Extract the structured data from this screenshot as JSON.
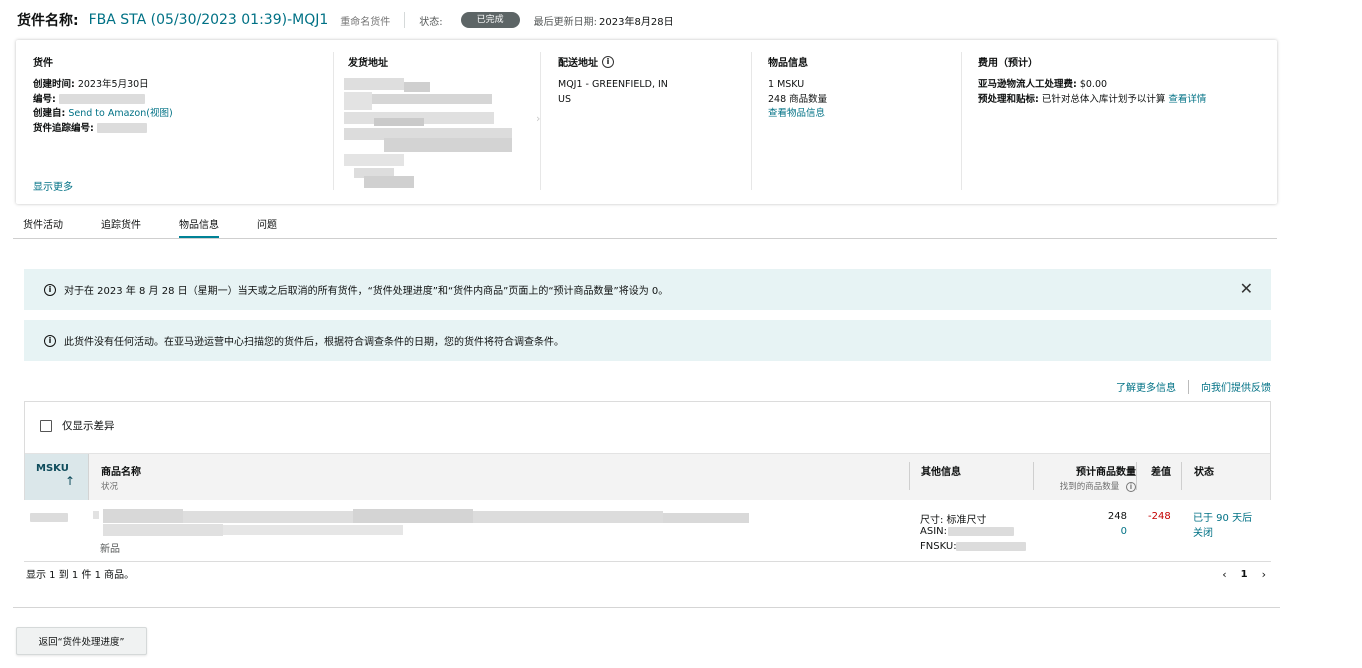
{
  "header": {
    "title_label": "货件名称:",
    "title_value": "FBA STA (05/30/2023 01:39)-MQJ1",
    "rename": "重命名货件",
    "status_label": "状态:",
    "status_badge": "已完成",
    "updated_label": "最后更新日期:",
    "updated_value": "2023年8月28日"
  },
  "card": {
    "shipment": {
      "heading": "货件",
      "created_label": "创建时间:",
      "created_value": "2023年5月30日",
      "id_label": "编号:",
      "created_from_label": "创建自:",
      "created_from_value": "Send to Amazon",
      "view_link": "(视图)",
      "tracking_label": "货件追踪编号:",
      "show_more": "显示更多"
    },
    "ship_from": {
      "heading": "发货地址"
    },
    "ship_to": {
      "heading": "配送地址",
      "line1": "MQJ1 - GREENFIELD, IN",
      "line2": "US"
    },
    "items": {
      "heading": "物品信息",
      "msku": "1 MSKU",
      "quantity": "248 商品数量",
      "view_link": "查看物品信息"
    },
    "fees": {
      "heading": "费用（预计）",
      "labor_label": "亚马逊物流人工处理费:",
      "labor_value": "$0.00",
      "prep_label": "预处理和贴标:",
      "prep_value": "已针对总体入库计划予以计算",
      "detail_link": "查看详情"
    }
  },
  "tabs": [
    "货件活动",
    "追踪货件",
    "物品信息",
    "问题"
  ],
  "alerts": {
    "cancel_notice": "对于在 2023 年 8 月 28 日（星期一）当天或之后取消的所有货件，“货件处理进度”和“货件内商品”页面上的“预计商品数量”将设为 0。",
    "no_activity": "此货件没有任何活动。在亚马逊运营中心扫描您的货件后，根据符合调查条件的日期，您的货件将符合调查条件。"
  },
  "links": {
    "learn_more": "了解更多信息",
    "feedback": "向我们提供反馈"
  },
  "table": {
    "filter_label": "仅显示差异",
    "headers": {
      "msku": "MSKU",
      "product_name": "商品名称",
      "product_sub": "状况",
      "other_info": "其他信息",
      "expected_qty": "预计商品数量",
      "found_qty": "找到的商品数量",
      "diff": "差值",
      "status": "状态"
    },
    "row": {
      "condition": "新品",
      "size": "尺寸: 标准尺寸",
      "asin_label": "ASIN:",
      "fnsku_label": "FNSKU:",
      "expected": "248",
      "found": "0",
      "diff": "-248",
      "status": "已于 90 天后关闭"
    }
  },
  "pagination": {
    "summary": "显示 1 到 1 件 1 商品。",
    "current_page": "1"
  },
  "footer": {
    "back_button": "返回“货件处理进度”"
  }
}
